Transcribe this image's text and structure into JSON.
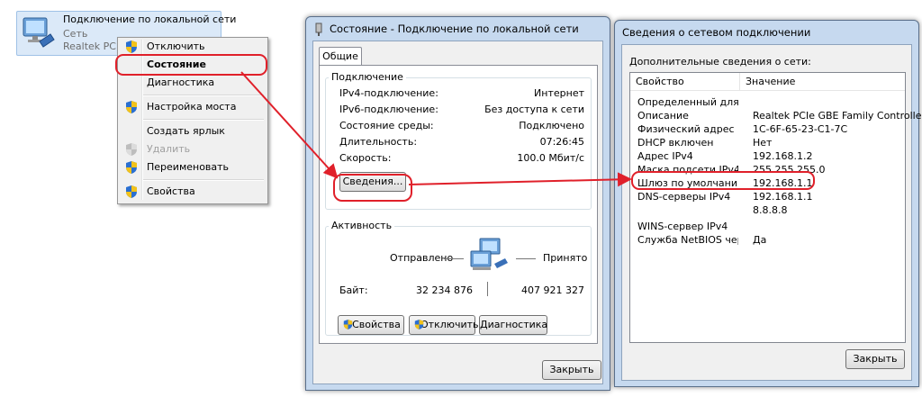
{
  "network_item": {
    "title": "Подключение по локальной сети",
    "subtitle": "Сеть",
    "adapter": "Realtek PCIe"
  },
  "context_menu": {
    "items": [
      {
        "label": "Отключить",
        "icon": "shield-icon"
      },
      {
        "label": "Состояние",
        "icon": ""
      },
      {
        "label": "Диагностика",
        "icon": ""
      },
      {
        "label": "Настройка моста",
        "icon": "shield-icon"
      },
      {
        "label": "Создать ярлык",
        "icon": ""
      },
      {
        "label": "Удалить",
        "icon": "shield-icon"
      },
      {
        "label": "Переименовать",
        "icon": "shield-icon"
      },
      {
        "label": "Свойства",
        "icon": "shield-icon"
      }
    ]
  },
  "status_window": {
    "title": "Состояние - Подключение по локальной сети",
    "tab": "Общие",
    "connection_group": "Подключение",
    "rows": [
      {
        "label": "IPv4-подключение:",
        "value": "Интернет"
      },
      {
        "label": "IPv6-подключение:",
        "value": "Без доступа к сети"
      },
      {
        "label": "Состояние среды:",
        "value": "Подключено"
      },
      {
        "label": "Длительность:",
        "value": "07:26:45"
      },
      {
        "label": "Скорость:",
        "value": "100.0 Мбит/с"
      }
    ],
    "details_button": "Сведения...",
    "activity_group": "Активность",
    "sent_label": "Отправлено",
    "received_label": "Принято",
    "bytes_label": "Байт:",
    "bytes_sent": "32 234 876",
    "bytes_received": "407 921 327",
    "properties_button": "Свойства",
    "disable_button": "Отключить",
    "diagnostics_button": "Диагностика",
    "close_button": "Закрыть"
  },
  "details_window": {
    "title": "Сведения о сетевом подключении",
    "caption": "Дополнительные сведения о сети:",
    "col_property": "Свойство",
    "col_value": "Значение",
    "rows": [
      {
        "property": "Определенный для по...",
        "value": ""
      },
      {
        "property": "Описание",
        "value": "Realtek PCIe GBE Family Controller"
      },
      {
        "property": "Физический адрес",
        "value": "1C-6F-65-23-C1-7C"
      },
      {
        "property": "DHCP включен",
        "value": "Нет"
      },
      {
        "property": "Адрес IPv4",
        "value": "192.168.1.2"
      },
      {
        "property": "Маска подсети IPv4",
        "value": "255.255.255.0"
      },
      {
        "property": "Шлюз по умолчанию IP...",
        "value": "192.168.1.1"
      },
      {
        "property": "DNS-серверы IPv4",
        "value": "192.168.1.1"
      },
      {
        "property": "",
        "value": "8.8.8.8"
      },
      {
        "property": "WINS-сервер IPv4",
        "value": ""
      },
      {
        "property": "Служба NetBIOS через...",
        "value": "Да"
      }
    ],
    "close_button": "Закрыть"
  },
  "colors": {
    "annotation": "#e0202a",
    "window_frame": "#c6d9ef",
    "selection": "#dbe9f8"
  }
}
